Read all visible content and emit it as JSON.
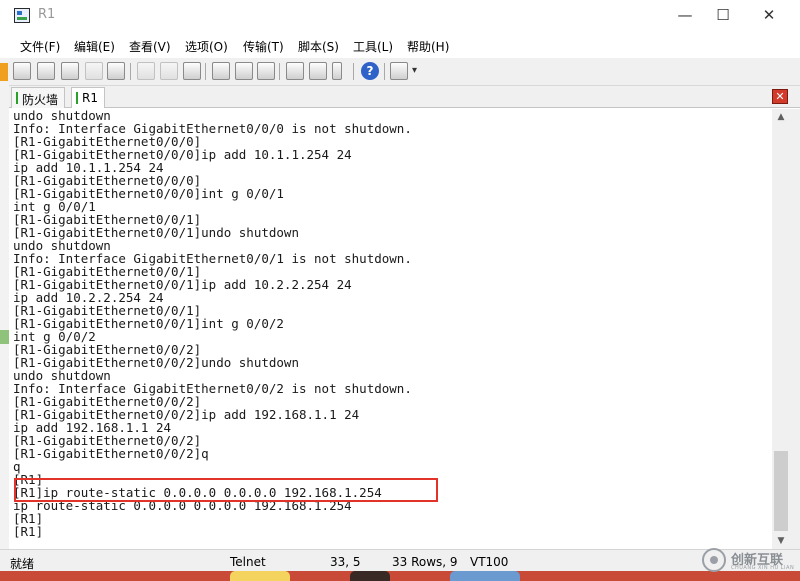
{
  "window": {
    "title": "R1",
    "minimize_glyph": "—",
    "maximize_glyph": "☐",
    "close_glyph": "✕"
  },
  "menu": [
    "文件(F)",
    "编辑(E)",
    "查看(V)",
    "选项(O)",
    "传输(T)",
    "脚本(S)",
    "工具(L)",
    "帮助(H)"
  ],
  "toolbar": {
    "help_glyph": "?",
    "more_glyph": "▾",
    "icons": [
      "connect-icon",
      "quick-connect-icon",
      "connect-tab-icon",
      "reconnect-icon",
      "disconnect-icon",
      "copy-icon",
      "paste-icon",
      "find-icon",
      "print-setup-icon",
      "print-screen-icon",
      "print-icon",
      "session-options-icon",
      "global-options-icon",
      "keymap-icon",
      "help-icon",
      "lock-icon"
    ]
  },
  "tabs": [
    {
      "label": "防火墙",
      "active": false
    },
    {
      "label": "R1",
      "active": true
    }
  ],
  "tab_close_glyph": "✕",
  "terminal": {
    "lines": [
      "undo shutdown",
      "Info: Interface GigabitEthernet0/0/0 is not shutdown.",
      "[R1-GigabitEthernet0/0/0]",
      "[R1-GigabitEthernet0/0/0]ip add 10.1.1.254 24",
      "ip add 10.1.1.254 24",
      "[R1-GigabitEthernet0/0/0]",
      "[R1-GigabitEthernet0/0/0]int g 0/0/1",
      "int g 0/0/1",
      "[R1-GigabitEthernet0/0/1]",
      "[R1-GigabitEthernet0/0/1]undo shutdown",
      "undo shutdown",
      "Info: Interface GigabitEthernet0/0/1 is not shutdown.",
      "[R1-GigabitEthernet0/0/1]",
      "[R1-GigabitEthernet0/0/1]ip add 10.2.2.254 24",
      "ip add 10.2.2.254 24",
      "[R1-GigabitEthernet0/0/1]",
      "[R1-GigabitEthernet0/0/1]int g 0/0/2",
      "int g 0/0/2",
      "[R1-GigabitEthernet0/0/2]",
      "[R1-GigabitEthernet0/0/2]undo shutdown",
      "undo shutdown",
      "Info: Interface GigabitEthernet0/0/2 is not shutdown.",
      "[R1-GigabitEthernet0/0/2]",
      "[R1-GigabitEthernet0/0/2]ip add 192.168.1.1 24",
      "ip add 192.168.1.1 24",
      "[R1-GigabitEthernet0/0/2]",
      "[R1-GigabitEthernet0/0/2]q",
      "q",
      "[R1]",
      "[R1]ip route-static 0.0.0.0 0.0.0.0 192.168.1.254",
      "ip route-static 0.0.0.0 0.0.0.0 192.168.1.254",
      "[R1]",
      "[R1]"
    ],
    "highlighted_line_index": 29,
    "highlight_color": "#e3322a"
  },
  "scrollbar": {
    "up_glyph": "▲",
    "down_glyph": "▼"
  },
  "status": {
    "ready": "就绪",
    "protocol": "Telnet",
    "cursor": "33,  5",
    "rows": "33 Rows, 9",
    "terminal_type": "VT100"
  },
  "watermark": {
    "text": "创新互联",
    "subtext": "CHUANG XIN HU LIAN"
  }
}
